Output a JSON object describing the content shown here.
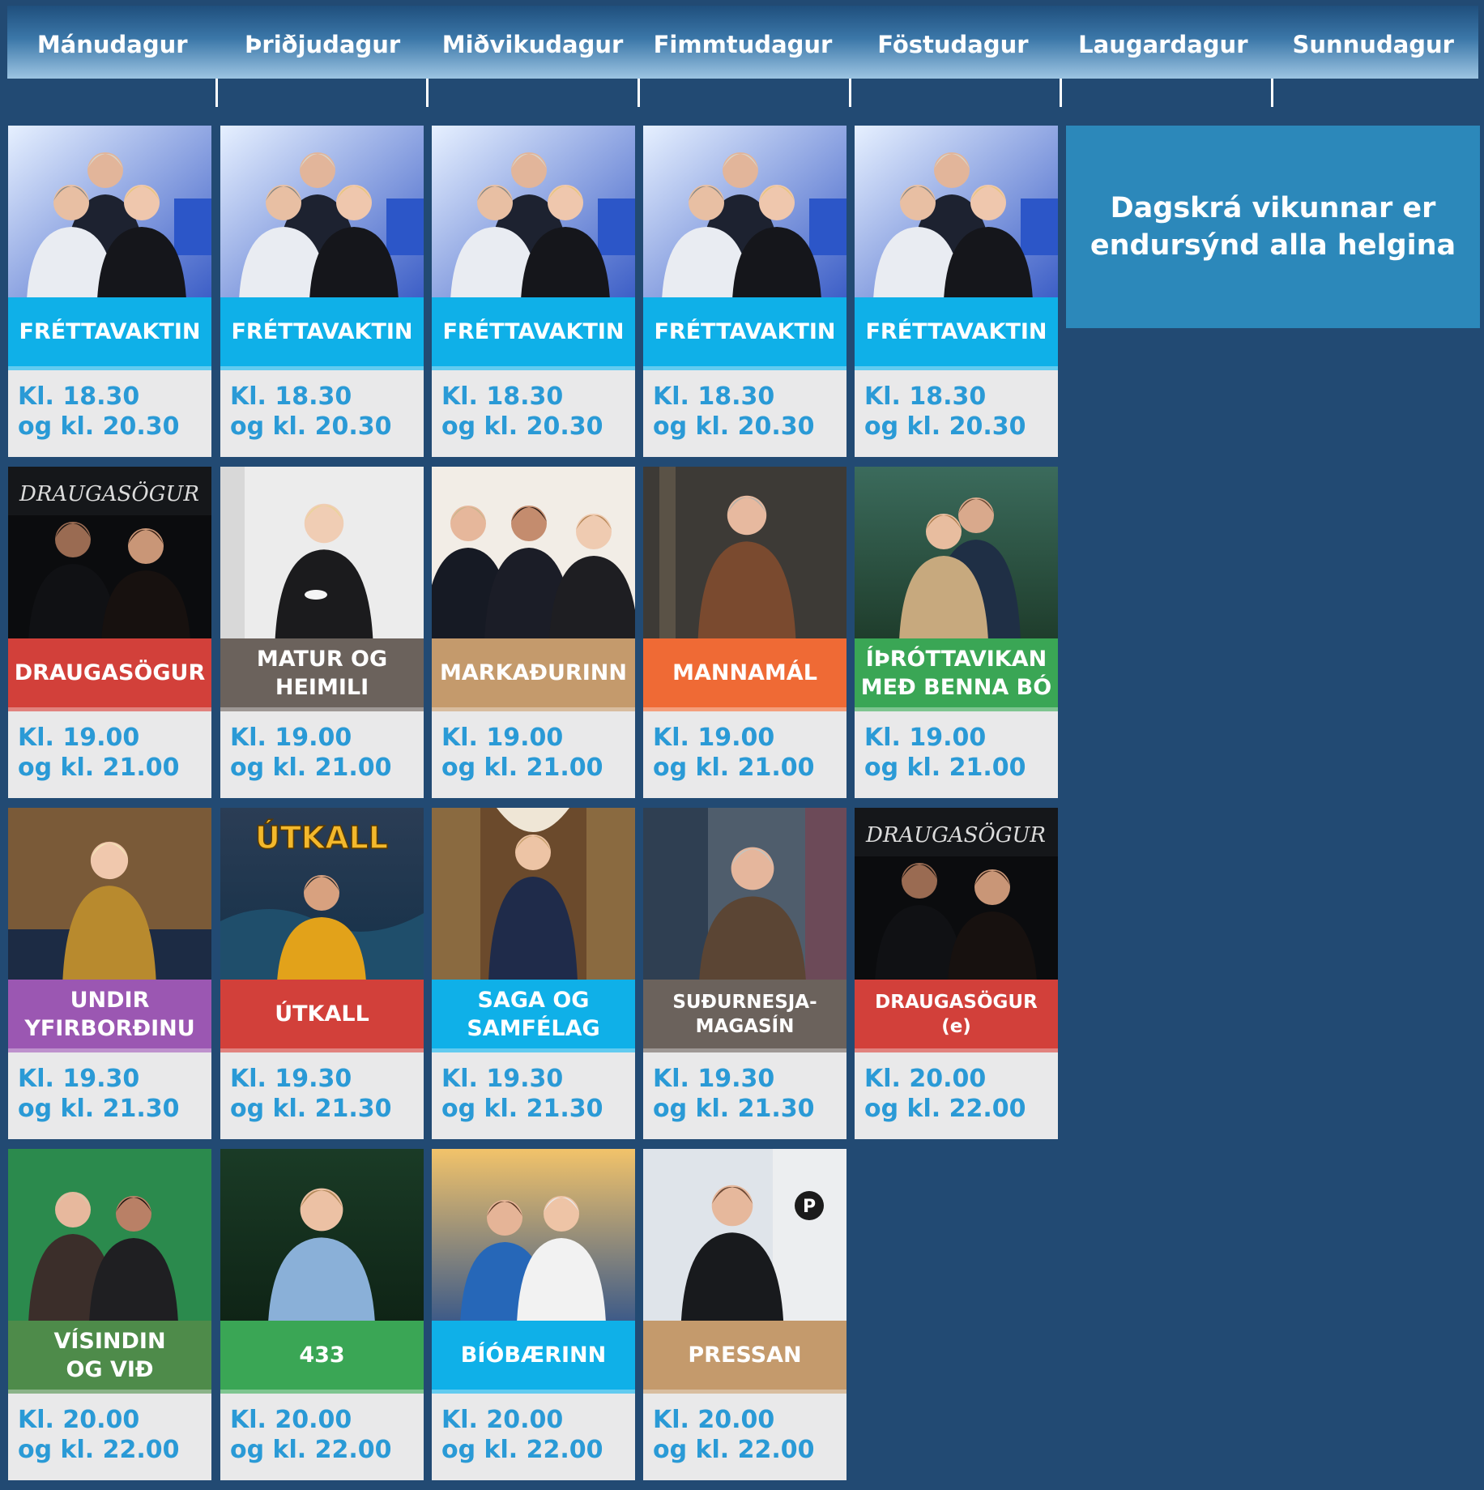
{
  "days": [
    "Mánudagur",
    "Þriðjudagur",
    "Miðvikudagur",
    "Fimmtudagur",
    "Föstudagur",
    "Laugardagur",
    "Sunnudagur"
  ],
  "notice": "Dagskrá vikunnar er endursýnd alla helgina",
  "colors": {
    "blue": "#0fb0e8",
    "red": "#d2403a",
    "taupe": "#6b625c",
    "tan": "#c49a6c",
    "orange": "#ef6a35",
    "green": "#3aa655",
    "purple": "#9b57b2",
    "dark_green": "#4e8b4a"
  },
  "schedule": [
    [
      {
        "title": "FRÉTTAVAKTIN",
        "time1": "Kl. 18.30",
        "time2": "og kl. 20.30",
        "image": "news-hosts-photo"
      },
      {
        "title": "DRAUGASÖGUR",
        "time1": "Kl. 19.00",
        "time2": "og kl. 21.00",
        "image": "ghost-stories-photo"
      },
      {
        "title": "UNDIR\nYFIRBORÐINU",
        "time1": "Kl. 19.30",
        "time2": "og kl. 21.30",
        "image": "host-on-sofa-photo"
      },
      {
        "title": "VÍSINDIN\nOG VIÐ",
        "time1": "Kl. 20.00",
        "time2": "og kl. 22.00",
        "image": "science-hosts-photo"
      }
    ],
    [
      {
        "title": "FRÉTTAVAKTIN",
        "time1": "Kl. 18.30",
        "time2": "og kl. 20.30",
        "image": "news-hosts-photo"
      },
      {
        "title": "MATUR OG\nHEIMILI",
        "time1": "Kl. 19.00",
        "time2": "og kl. 21.00",
        "image": "host-with-cup-photo"
      },
      {
        "title": "ÚTKALL",
        "time1": "Kl. 19.30",
        "time2": "og kl. 21.30",
        "image": "rescue-sea-photo"
      },
      {
        "title": "433",
        "time1": "Kl. 20.00",
        "time2": "og kl. 22.00",
        "image": "host-glasses-photo"
      }
    ],
    [
      {
        "title": "FRÉTTAVAKTIN",
        "time1": "Kl. 18.30",
        "time2": "og kl. 20.30",
        "image": "news-hosts-photo"
      },
      {
        "title": "MARKAÐURINN",
        "time1": "Kl. 19.00",
        "time2": "og kl. 21.00",
        "image": "business-hosts-photo"
      },
      {
        "title": "SAGA OG\nSAMFÉLAG",
        "time1": "Kl. 19.30",
        "time2": "og kl. 21.30",
        "image": "library-host-photo"
      },
      {
        "title": "BÍÓBÆRINN",
        "time1": "Kl. 20.00",
        "time2": "og kl. 22.00",
        "image": "cinema-hosts-photo"
      }
    ],
    [
      {
        "title": "FRÉTTAVAKTIN",
        "time1": "Kl. 18.30",
        "time2": "og kl. 20.30",
        "image": "news-hosts-photo"
      },
      {
        "title": "MANNAMÁL",
        "time1": "Kl. 19.00",
        "time2": "og kl. 21.00",
        "image": "host-in-chair-photo"
      },
      {
        "title": "SUÐURNESJA-\nMAGASÍN",
        "time1": "Kl. 19.30",
        "time2": "og kl. 21.30",
        "image": "host-harbor-photo"
      },
      {
        "title": "PRESSAN",
        "time1": "Kl. 20.00",
        "time2": "og kl. 22.00",
        "image": "pressan-host-photo"
      }
    ],
    [
      {
        "title": "FRÉTTAVAKTIN",
        "time1": "Kl. 18.30",
        "time2": "og kl. 20.30",
        "image": "news-hosts-photo"
      },
      {
        "title": "ÍÞRÓTTAVIKAN\nMEÐ BENNA BÓ",
        "time1": "Kl. 19.00",
        "time2": "og kl. 21.00",
        "image": "sports-hosts-photo"
      },
      {
        "title": "DRAUGASÖGUR (e)",
        "time1": "Kl. 20.00",
        "time2": "og kl. 22.00",
        "image": "ghost-stories-photo"
      }
    ]
  ],
  "logo_text": {
    "draugasogur": "DRAUGASÖGUR",
    "utkall": "ÚTKALL",
    "pressan": "P"
  }
}
